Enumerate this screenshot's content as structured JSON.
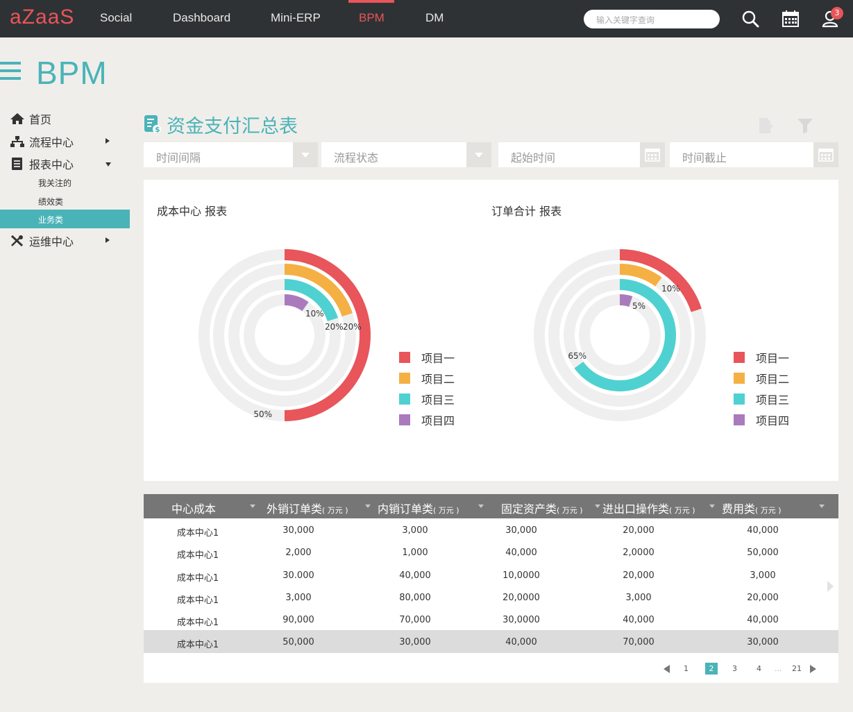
{
  "app": {
    "logo": "aZaaS",
    "nav": [
      {
        "label": "Social"
      },
      {
        "label": "Dashboard"
      },
      {
        "label": "Mini-ERP"
      },
      {
        "label": "BPM"
      },
      {
        "label": "DM"
      }
    ],
    "active_nav": "BPM",
    "search_placeholder": "输入关键字查询",
    "notification_count": "3",
    "colors": {
      "accent": "#4ab3b8",
      "brand": "#e8555a",
      "topbar": "#2f3234"
    }
  },
  "page": {
    "title": "BPM"
  },
  "sidebar": {
    "items": [
      {
        "label": "首页",
        "icon": "home-icon"
      },
      {
        "label": "流程中心",
        "icon": "sitemap-icon"
      },
      {
        "label": "报表中心",
        "icon": "list-icon"
      },
      {
        "label": "运维中心",
        "icon": "tools-icon"
      }
    ],
    "sub_items": [
      {
        "label": "我关注的"
      },
      {
        "label": "绩效类"
      },
      {
        "label": "业务类"
      }
    ],
    "active_sub": "业务类"
  },
  "content": {
    "title": "资金支付汇总表",
    "filters": [
      {
        "placeholder": "时间间隔",
        "control": "dropdown"
      },
      {
        "placeholder": "流程状态",
        "control": "dropdown"
      },
      {
        "placeholder": "起始时间",
        "control": "calendar"
      },
      {
        "placeholder": "时间截止",
        "control": "calendar"
      }
    ]
  },
  "chart_data": [
    {
      "type": "pie",
      "title": "成本中心  报表",
      "subtype": "concentric radial rings",
      "categories": [
        "项目一",
        "项目二",
        "项目三",
        "项目四"
      ],
      "values": [
        50,
        20,
        20,
        10
      ],
      "labels": [
        "50%",
        "20%",
        "20%",
        "10%"
      ],
      "colors": [
        "#e8555a",
        "#f5b043",
        "#4fd1d1",
        "#a97bbd"
      ],
      "legend": "right"
    },
    {
      "type": "pie",
      "title": "订单合计  报表",
      "subtype": "concentric radial rings",
      "categories": [
        "项目一",
        "项目二",
        "项目三",
        "项目四"
      ],
      "values": [
        20,
        10,
        65,
        5
      ],
      "labels": [
        "",
        "10%",
        "65%",
        "5%"
      ],
      "colors": [
        "#e8555a",
        "#f5b043",
        "#4fd1d1",
        "#a97bbd"
      ],
      "legend": "right"
    }
  ],
  "table": {
    "columns": [
      {
        "label": "中心成本",
        "unit": ""
      },
      {
        "label": "外销订单类",
        "unit": "( 万元 )"
      },
      {
        "label": "内销订单类",
        "unit": "( 万元 )"
      },
      {
        "label": "固定资产类",
        "unit": "( 万元 )"
      },
      {
        "label": "进出口操作类",
        "unit": "( 万元 )"
      },
      {
        "label": "费用类",
        "unit": "( 万元 )"
      }
    ],
    "rows": [
      [
        "成本中心1",
        "30,000",
        "3,000",
        "30,000",
        "20,000",
        "40,000"
      ],
      [
        "成本中心1",
        "2,000",
        "1,000",
        "40,000",
        "2,0000",
        "50,000"
      ],
      [
        "成本中心1",
        "30.000",
        "40,000",
        "10,0000",
        "20,000",
        "3,000"
      ],
      [
        "成本中心1",
        "3,000",
        "80,000",
        "20,0000",
        "3,000",
        "20,000"
      ],
      [
        "成本中心1",
        "90,000",
        "70,000",
        "30,0000",
        "40,000",
        "40,000"
      ],
      [
        "成本中心1",
        "50,000",
        "30,000",
        "40,000",
        "70,000",
        "30,000"
      ]
    ],
    "selected_row": 5
  },
  "pagination": {
    "pages": [
      "1",
      "2",
      "3",
      "4",
      "...",
      "21"
    ],
    "current": "2"
  }
}
